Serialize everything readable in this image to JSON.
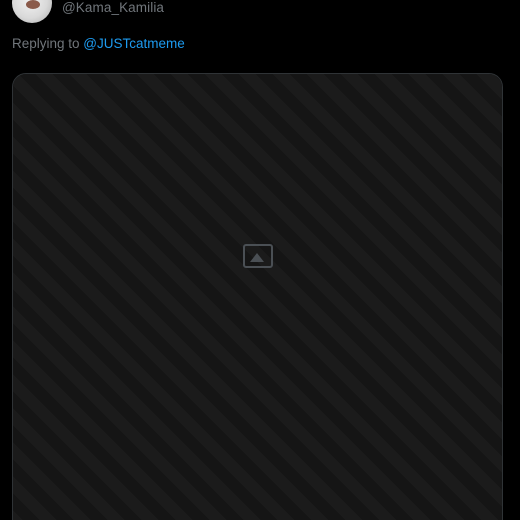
{
  "author": {
    "handle": "@Kama_Kamilia",
    "avatar_icon": "avatar-image"
  },
  "reply": {
    "prefix": "Replying to ",
    "mention": "@JUSTcatmeme"
  },
  "media": {
    "icon": "image-icon"
  },
  "colors": {
    "background": "#000000",
    "muted_text": "#71767b",
    "link": "#1d9bf0",
    "card_border": "#2f3336"
  }
}
